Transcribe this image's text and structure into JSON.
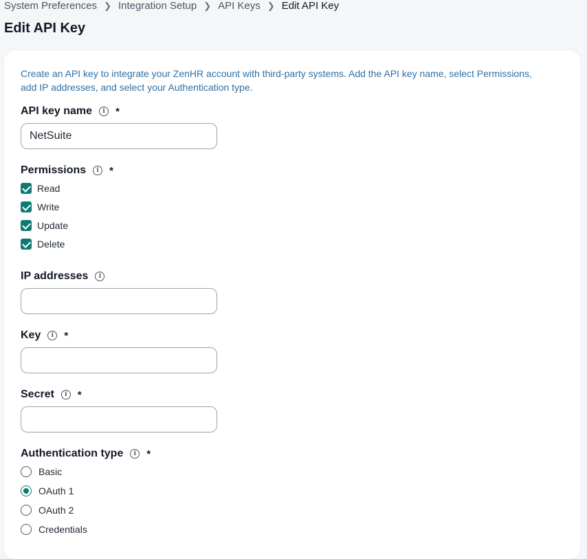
{
  "breadcrumb": [
    "System Preferences",
    "Integration Setup",
    "API Keys",
    "Edit API Key"
  ],
  "page_title": "Edit API Key",
  "intro": "Create an API key to integrate your ZenHR account with third-party systems. Add the API key name, select Permissions, add IP addresses, and select your Authentication type.",
  "fields": {
    "api_key_name": {
      "label": "API key name",
      "value": "NetSuite",
      "required": "*"
    },
    "permissions": {
      "label": "Permissions",
      "required": "*",
      "options": [
        "Read",
        "Write",
        "Update",
        "Delete"
      ]
    },
    "ip_addresses": {
      "label": "IP addresses",
      "value": ""
    },
    "key": {
      "label": "Key",
      "value": "",
      "required": "*"
    },
    "secret": {
      "label": "Secret",
      "value": "",
      "required": "*"
    },
    "auth_type": {
      "label": "Authentication type",
      "required": "*",
      "options": [
        "Basic",
        "OAuth 1",
        "OAuth 2",
        "Credentials"
      ],
      "selected": "OAuth 1"
    }
  },
  "icons": {
    "info": "info-icon",
    "breadcrumb_sep": "chevron-right-icon"
  },
  "colors": {
    "accent": "#0f7a74",
    "intro_text": "#2f6fa3"
  }
}
